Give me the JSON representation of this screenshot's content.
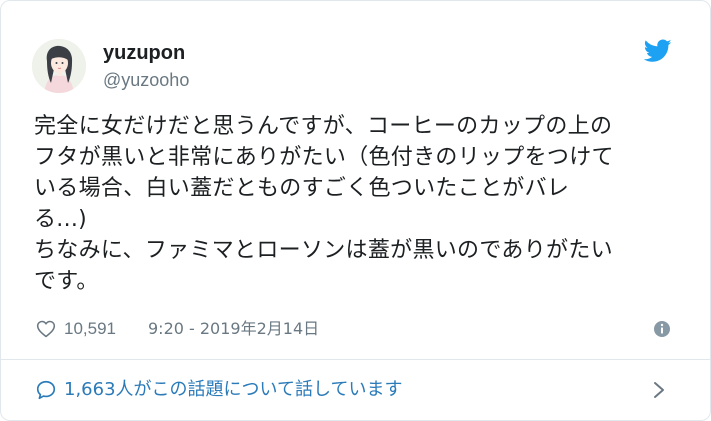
{
  "author": {
    "display_name": "yuzupon",
    "screen_name": "@yuzooho",
    "avatar_icon": "avatar-illustration-icon"
  },
  "brand": {
    "icon": "twitter-bird-icon",
    "color": "#1da1f2"
  },
  "tweet": {
    "lines": [
      "完全に女だけだと思うんですが、コーヒーのカップの上の",
      "フタが黒いと非常にありがたい（色付きのリップをつけて",
      "いる場合、白い蓋だとものすごく色ついたことがバレ",
      "る...)",
      "ちなみに、ファミマとローソンは蓋が黒いのでありがたい",
      "です。"
    ]
  },
  "meta": {
    "like_icon": "heart-icon",
    "like_count": "10,591",
    "timestamp": "9:20 - 2019年2月14日",
    "info_icon": "info-icon"
  },
  "footer": {
    "icon": "speech-bubble-icon",
    "conversation_text": "1,663人がこの話題について話しています",
    "chevron_icon": "chevron-right-icon",
    "link_color": "#2b7bb9"
  },
  "colors": {
    "text": "#1c2022",
    "secondary": "#697882",
    "border": "#e1e8ed"
  }
}
